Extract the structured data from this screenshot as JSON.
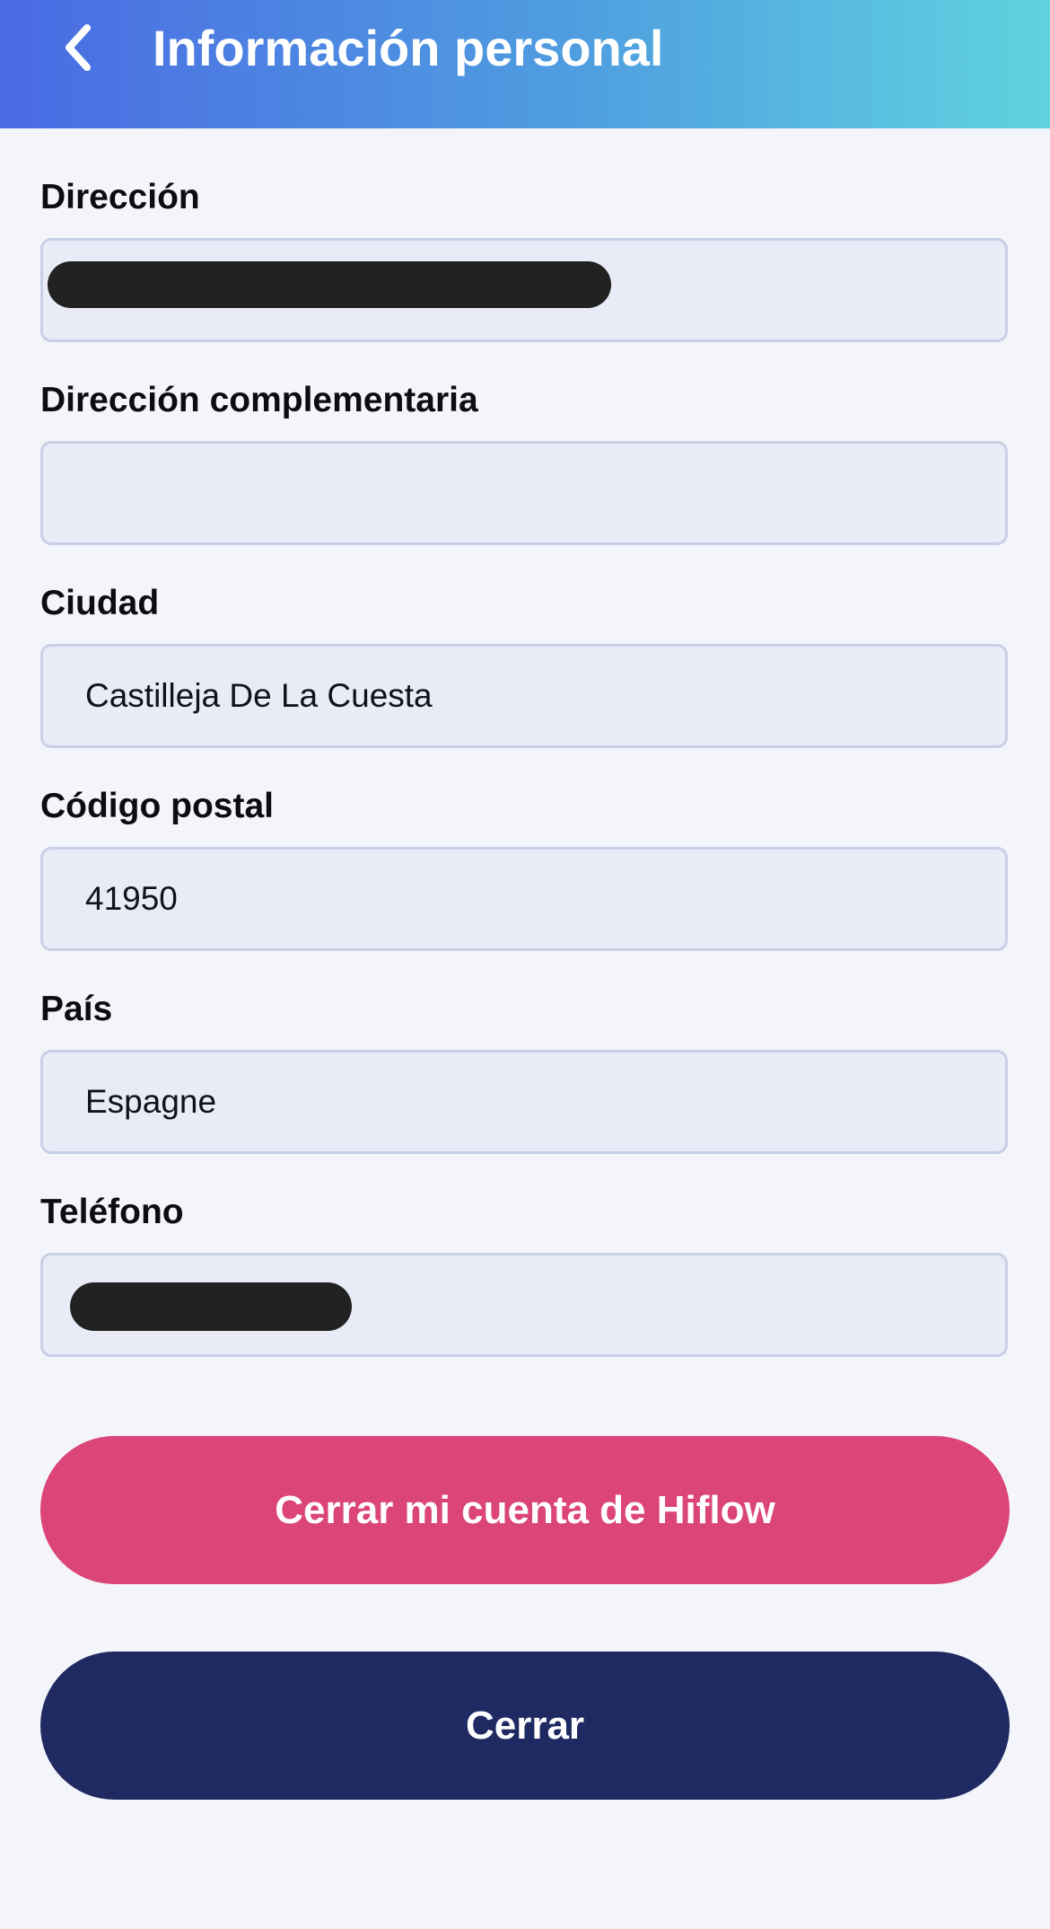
{
  "header": {
    "title": "Información personal",
    "back_icon": "chevron-left-icon",
    "gradient_start": "#4a6ae3",
    "gradient_end": "#5fd3df"
  },
  "fields": {
    "address": {
      "label": "Dirección",
      "value": ""
    },
    "address2": {
      "label": "Dirección complementaria",
      "value": ""
    },
    "city": {
      "label": "Ciudad",
      "value": "Castilleja De La Cuesta"
    },
    "postal": {
      "label": "Código postal",
      "value": "41950"
    },
    "country": {
      "label": "País",
      "value": "Espagne"
    },
    "phone": {
      "label": "Teléfono",
      "value": ""
    }
  },
  "buttons": {
    "close_account": {
      "label": "Cerrar mi cuenta de Hiflow",
      "color": "#db4577"
    },
    "close": {
      "label": "Cerrar",
      "color": "#1f2a62"
    }
  }
}
